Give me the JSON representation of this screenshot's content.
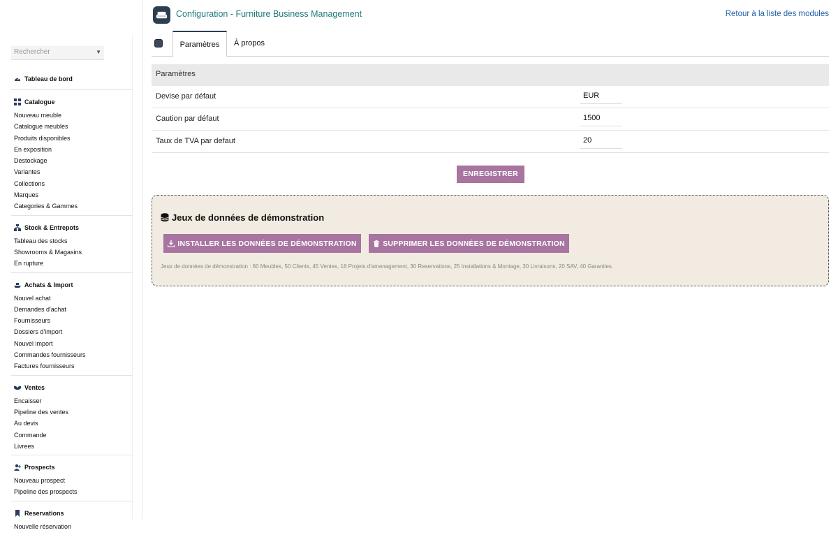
{
  "header": {
    "title": "Configuration - Furniture Business Management",
    "back_link": "Retour à la liste des modules"
  },
  "sidebar": {
    "search_placeholder": "Rechercher",
    "sections": [
      {
        "title": "Tableau de bord",
        "items": []
      },
      {
        "title": "Catalogue",
        "items": [
          "Nouveau meuble",
          "Catalogue meubles",
          "Produits disponibles",
          "En exposition",
          "Destockage",
          "Variantes",
          "Collections",
          "Marques",
          "Categories & Gammes"
        ]
      },
      {
        "title": "Stock & Entrepots",
        "items": [
          "Tableau des stocks",
          "Showrooms & Magasins",
          "En rupture"
        ]
      },
      {
        "title": "Achats & Import",
        "items": [
          "Nouvel achat",
          "Demandes d'achat",
          "Fournisseurs",
          "Dossiers d'import",
          "Nouvel import",
          "Commandes fournisseurs",
          "Factures fournisseurs"
        ]
      },
      {
        "title": "Ventes",
        "items": [
          "Encaisser",
          "Pipeline des ventes",
          "Au devis",
          "Commande",
          "Livrees"
        ]
      },
      {
        "title": "Prospects",
        "items": [
          "Nouveau prospect",
          "Pipeline des prospects"
        ]
      },
      {
        "title": "Reservations",
        "items": [
          "Nouvelle réservation"
        ]
      }
    ]
  },
  "tabs": {
    "params": "Paramètres",
    "about": "À propos"
  },
  "params": {
    "heading": "Paramètres",
    "rows": [
      {
        "label": "Devise par défaut",
        "value": "EUR"
      },
      {
        "label": "Caution par défaut",
        "value": "1500"
      },
      {
        "label": "Taux de TVA par defaut",
        "value": "20"
      }
    ],
    "save_label": "ENREGISTRER"
  },
  "demo": {
    "title": "Jeux de données de démonstration",
    "install_label": "INSTALLER LES DONNÉES DE DÉMONSTRATION",
    "delete_label": "SUPPRIMER LES DONNÉES DE DÉMONSTRATION",
    "note": "Jeux de données de démonstration : 60 Meubles, 50 Clients, 45 Ventes, 18 Projets d'amenagement, 30 Reservations, 25 Installations & Montage, 30 Livraisons, 20 SAV, 40 Garanties."
  },
  "colors": {
    "accent": "#a874a0",
    "title": "#1f7a7a",
    "link": "#1f5fa8",
    "demo_bg": "#f1ebe2"
  }
}
